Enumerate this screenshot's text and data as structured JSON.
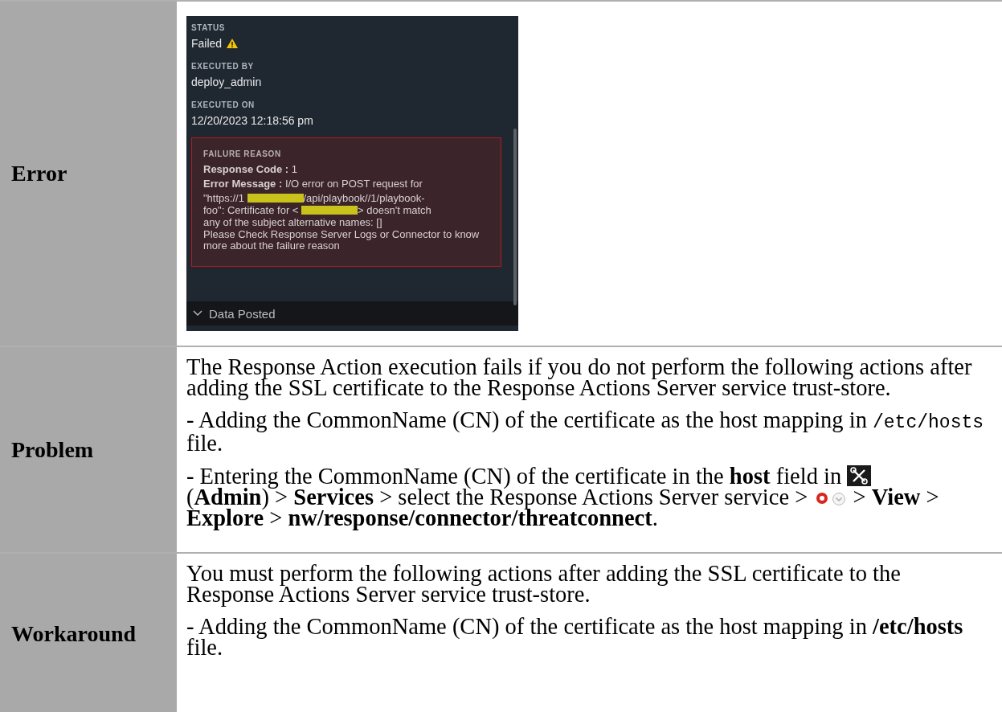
{
  "rows": [
    {
      "label": "Error",
      "kind": "screenshot",
      "screenshot": {
        "fields": [
          {
            "label": "STATUS",
            "value": "Failed",
            "warning": true
          },
          {
            "label": "EXECUTED BY",
            "value": "deploy_admin",
            "warning": false
          },
          {
            "label": "EXECUTED ON",
            "value": "12/20/2023 12:18:56 pm",
            "warning": false
          }
        ],
        "failure": {
          "title": "FAILURE REASON",
          "lines": [
            [
              {
                "kind": "text",
                "text": "**Response Code :** 1"
              }
            ],
            [
              {
                "kind": "text",
                "text": "**Error Message :** I/O error on POST request for"
              }
            ],
            [
              {
                "kind": "text",
                "text": "\"https://1"
              },
              {
                "kind": "redaction"
              },
              {
                "kind": "text",
                "text": "/api/playbook//1/playbook-"
              }
            ],
            [
              {
                "kind": "text",
                "text": "foo\": Certificate for <"
              },
              {
                "kind": "redaction"
              },
              {
                "kind": "text",
                "text": "> doesn't match"
              }
            ],
            [
              {
                "kind": "text",
                "text": "any of the subject alternative names: []"
              }
            ],
            [
              {
                "kind": "text",
                "text": "Please Check Response Server Logs or Connector to know more about the failure reason"
              }
            ]
          ]
        },
        "section": {
          "label": "Data Posted",
          "expanded": false
        }
      }
    },
    {
      "label": "Problem",
      "kind": "paragraphs",
      "paragraphs": [
        [
          {
            "kind": "text",
            "text": "The Response Action execution fails if you do not perform the following actions after adding the SSL certificate to the Response Actions Server service trust-store."
          }
        ],
        [
          {
            "kind": "text",
            "text": "- Adding the CommonName (CN) of the certificate as the host mapping in"
          },
          {
            "kind": "code",
            "text": "/etc/hosts"
          },
          {
            "kind": "text",
            "text": "file."
          }
        ],
        [
          {
            "kind": "text",
            "text": "- Entering the CommonName (CN) of the certificate in the **host** field in"
          },
          {
            "kind": "tools-icon"
          },
          {
            "kind": "text",
            "text": "(**Admin**) > **Services** > select the Response Actions Server service >"
          },
          {
            "kind": "gear-icon"
          },
          {
            "kind": "chevron-icon"
          },
          {
            "kind": "text",
            "text": "> **View** >"
          },
          {
            "kind": "text",
            "text": "**Explore** > **nw/response/connector/threatconnect**."
          }
        ]
      ]
    },
    {
      "label": "Workaround",
      "kind": "paragraphs",
      "paragraphs": [
        [
          {
            "kind": "text",
            "text": "You must perform the following actions after adding the SSL certificate to the Response Actions Server service trust-store."
          }
        ],
        [
          {
            "kind": "text",
            "text": "- Adding the CommonName (CN) of the certificate as the host mapping in **/etc/hosts** file."
          }
        ]
      ]
    }
  ]
}
